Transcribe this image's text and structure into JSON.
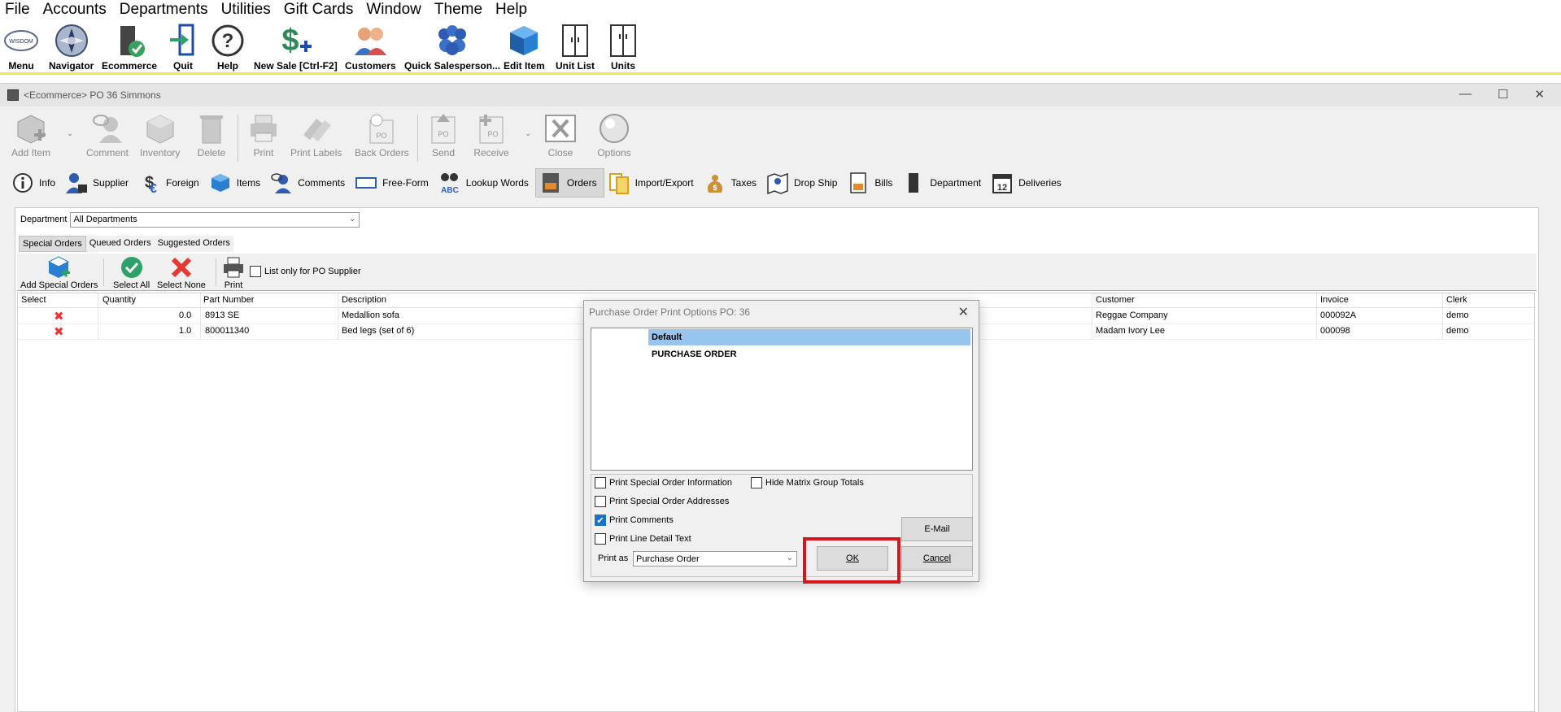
{
  "menubar": [
    "File",
    "Accounts",
    "Departments",
    "Utilities",
    "Gift Cards",
    "Window",
    "Theme",
    "Help"
  ],
  "main_toolbar": [
    {
      "label": "Menu",
      "icon": "logo-badge-icon"
    },
    {
      "label": "Navigator",
      "icon": "compass-icon"
    },
    {
      "label": "Ecommerce",
      "icon": "door-check-icon"
    },
    {
      "label": "Quit",
      "icon": "exit-door-icon"
    },
    {
      "label": "Help",
      "icon": "question-circle-icon"
    },
    {
      "label": "New Sale [Ctrl-F2]",
      "icon": "dollar-plus-icon"
    },
    {
      "label": "Customers",
      "icon": "people-icon"
    },
    {
      "label": "Quick Salesperson...",
      "icon": "group-icon"
    },
    {
      "label": "Edit Item",
      "icon": "box-icon"
    },
    {
      "label": "Unit List",
      "icon": "cabinet-icon"
    },
    {
      "label": "Units",
      "icon": "wardrobe-icon"
    }
  ],
  "window": {
    "title": "<Ecommerce> PO 36 Simmons",
    "controls": [
      "minimize",
      "maximize",
      "close"
    ]
  },
  "window_toolbar": [
    {
      "label": "Add Item"
    },
    {
      "label": "Comment"
    },
    {
      "label": "Inventory"
    },
    {
      "label": "Delete"
    },
    {
      "label": "Print"
    },
    {
      "label": "Print Labels"
    },
    {
      "label": "Back Orders"
    },
    {
      "label": "Send"
    },
    {
      "label": "Receive"
    },
    {
      "label": "Close"
    },
    {
      "label": "Options"
    }
  ],
  "tabs": [
    {
      "label": "Info"
    },
    {
      "label": "Supplier"
    },
    {
      "label": "Foreign"
    },
    {
      "label": "Items"
    },
    {
      "label": "Comments"
    },
    {
      "label": "Free-Form"
    },
    {
      "label": "Lookup Words"
    },
    {
      "label": "Orders",
      "active": true
    },
    {
      "label": "Import/Export"
    },
    {
      "label": "Taxes"
    },
    {
      "label": "Drop Ship"
    },
    {
      "label": "Bills"
    },
    {
      "label": "Department"
    },
    {
      "label": "Deliveries"
    }
  ],
  "department": {
    "label": "Department",
    "value": "All Departments"
  },
  "subtabs": [
    "Special Orders",
    "Queued Orders",
    "Suggested Orders"
  ],
  "so_toolbar": {
    "add_special_orders": "Add Special Orders",
    "select_all": "Select All",
    "select_none": "Select None",
    "print": "Print",
    "list_only_label": "List only for PO Supplier"
  },
  "grid": {
    "columns": [
      "Select",
      "Quantity",
      "Part Number",
      "Description",
      "Customer",
      "Invoice",
      "Clerk"
    ],
    "rows": [
      {
        "quantity": "0.0",
        "part": "8913 SE",
        "description": "Medallion sofa",
        "customer": "Reggae Company",
        "invoice": "000092A",
        "clerk": "demo"
      },
      {
        "quantity": "1.0",
        "part": "800011340",
        "description": "Bed legs (set of 6)",
        "customer": "Madam Ivory Lee",
        "invoice": "000098",
        "clerk": "demo"
      }
    ]
  },
  "dialog": {
    "title": "Purchase Order Print Options  PO: 36",
    "list_items": [
      "Default",
      "PURCHASE ORDER"
    ],
    "options": {
      "print_special_order_information": "Print Special Order Information",
      "print_special_order_addresses": "Print Special Order Addresses",
      "print_comments": "Print Comments",
      "print_line_detail_text": "Print Line Detail Text",
      "hide_matrix_group_totals": "Hide Matrix Group Totals"
    },
    "print_as_label": "Print as",
    "print_as_value": "Purchase Order",
    "email_label": "E-Mail",
    "ok_label": "OK",
    "cancel_label": "Cancel"
  },
  "colors": {
    "highlight": "#d9141f",
    "selected_row": "#99c4ee",
    "checkbox_on": "#1a73c8",
    "toolbar_accent": "#f5e84b"
  }
}
